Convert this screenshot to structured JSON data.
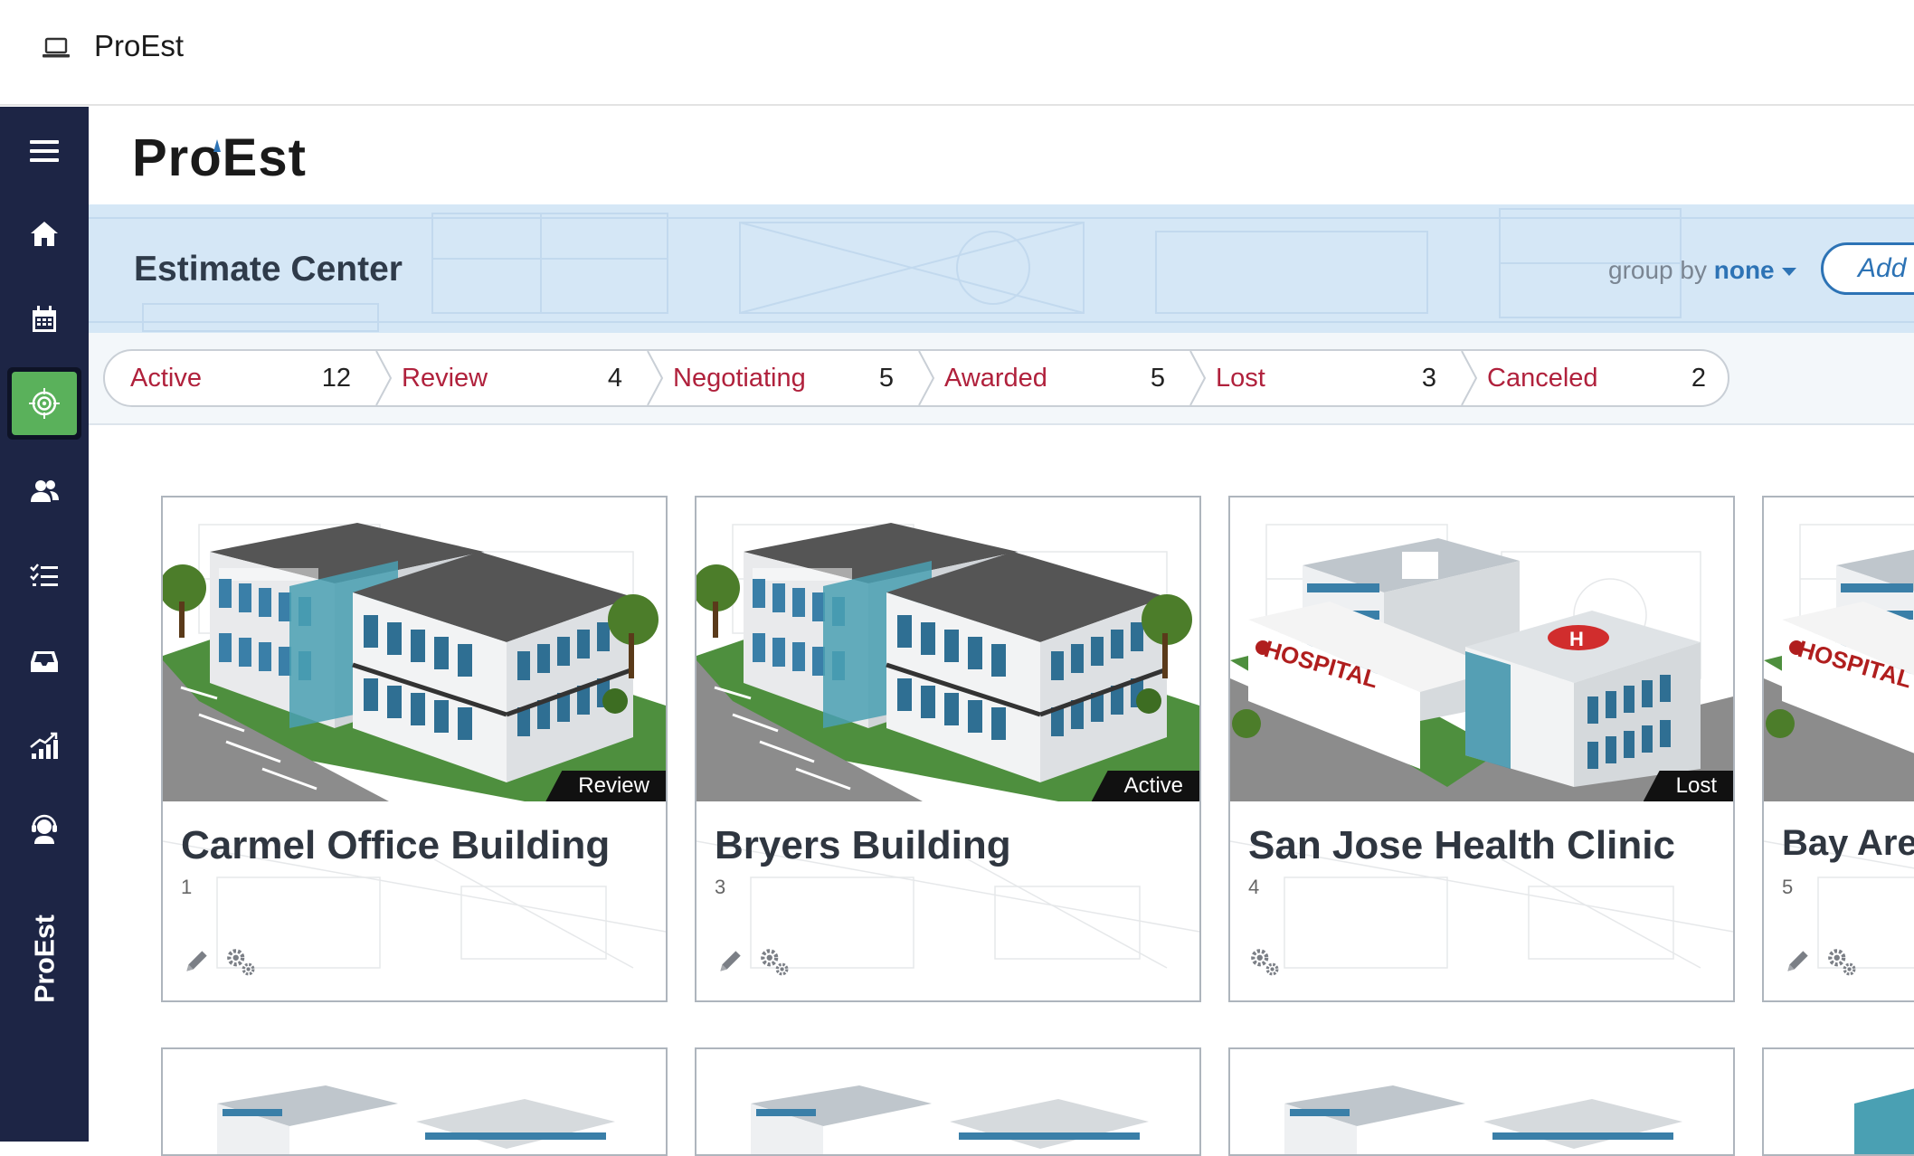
{
  "window": {
    "title": "ProEst"
  },
  "brand": {
    "name": "ProEst"
  },
  "page": {
    "title": "Estimate Center"
  },
  "group_by": {
    "label": "group by",
    "value": "none"
  },
  "add_button": {
    "label": "Add n"
  },
  "filters": [
    {
      "label": "Active",
      "count": "12"
    },
    {
      "label": "Review",
      "count": "4"
    },
    {
      "label": "Negotiating",
      "count": "5"
    },
    {
      "label": "Awarded",
      "count": "5"
    },
    {
      "label": "Lost",
      "count": "3"
    },
    {
      "label": "Canceled",
      "count": "2"
    }
  ],
  "cards": [
    {
      "name": "Carmel Office Building",
      "number": "1",
      "status": "Review",
      "image": "office-building"
    },
    {
      "name": "Bryers Building",
      "number": "3",
      "status": "Active",
      "image": "office-building"
    },
    {
      "name": "San Jose Health Clinic",
      "number": "4",
      "status": "Lost",
      "image": "hospital",
      "sign": "HOSPITAL"
    },
    {
      "name": "Bay Area",
      "number": "5",
      "status": "",
      "image": "hospital",
      "sign": "HOSPITAL"
    }
  ],
  "sidebar_icons": [
    "menu-icon",
    "home-icon",
    "calendar-icon",
    "target-icon",
    "users-icon",
    "checklist-icon",
    "inbox-icon",
    "chart-icon",
    "support-icon"
  ],
  "colors": {
    "sidebar": "#1d2545",
    "active_nav": "#5ab15b",
    "status_red": "#b0213c",
    "link_blue": "#2d73b5"
  }
}
